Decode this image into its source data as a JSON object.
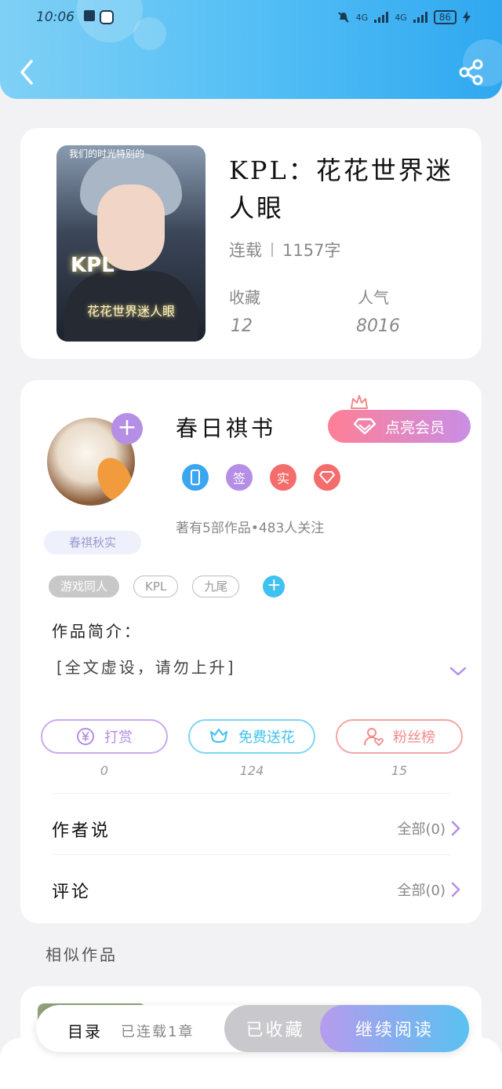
{
  "status_bar": {
    "time": "10:06",
    "signal_1": "4G",
    "signal_2": "4G",
    "battery": "86"
  },
  "book": {
    "title": "KPL：花花世界迷人眼",
    "status": "连载",
    "word_count": "1157字",
    "collect_label": "收藏",
    "collect_value": "12",
    "popularity_label": "人气",
    "popularity_value": "8016",
    "cover": {
      "top_text": "我们的时光特别的",
      "kpl_text": "KPL",
      "bottom_text": "花花世界迷人眼"
    }
  },
  "author": {
    "name": "春日祺书",
    "tagline": "春祺秋实",
    "vip_label": "点亮会员",
    "badges": [
      {
        "icon": "phone-icon",
        "text": "",
        "color": "#3aa6f0"
      },
      {
        "icon": "sign-icon",
        "text": "签",
        "color": "#b58ee6"
      },
      {
        "icon": "real-icon",
        "text": "实",
        "color": "#f46d6d"
      },
      {
        "icon": "diamond-icon",
        "text": "",
        "color": "#f46d6d"
      }
    ],
    "stats": "著有5部作品•483人关注"
  },
  "tags": [
    "游戏同人",
    "KPL",
    "九尾"
  ],
  "intro": {
    "label": "作品简介：",
    "text": "[全文虚设，请勿上升]"
  },
  "actions": [
    {
      "label": "打赏",
      "count": "0",
      "color": "#b58ee6",
      "icon": "yuan-icon"
    },
    {
      "label": "免费送花",
      "count": "124",
      "color": "#3fc2f0",
      "icon": "flower-icon"
    },
    {
      "label": "粉丝榜",
      "count": "15",
      "color": "#f48a8a",
      "icon": "fan-icon"
    }
  ],
  "author_says": {
    "label": "作者说",
    "link": "全部(0)"
  },
  "comments": {
    "label": "评论",
    "link": "全部(0)"
  },
  "similar": {
    "label": "相似作品"
  },
  "bottom_bar": {
    "toc_label": "目录",
    "toc_sub": "已连载1章",
    "collected_label": "已收藏",
    "read_label": "继续阅读"
  },
  "colors": {
    "header_gradient_start": "#7fd0f5",
    "header_gradient_end": "#2fa8f0",
    "accent_purple": "#b58ee6",
    "accent_blue": "#3fc2f0",
    "accent_pink": "#f48a8a"
  }
}
